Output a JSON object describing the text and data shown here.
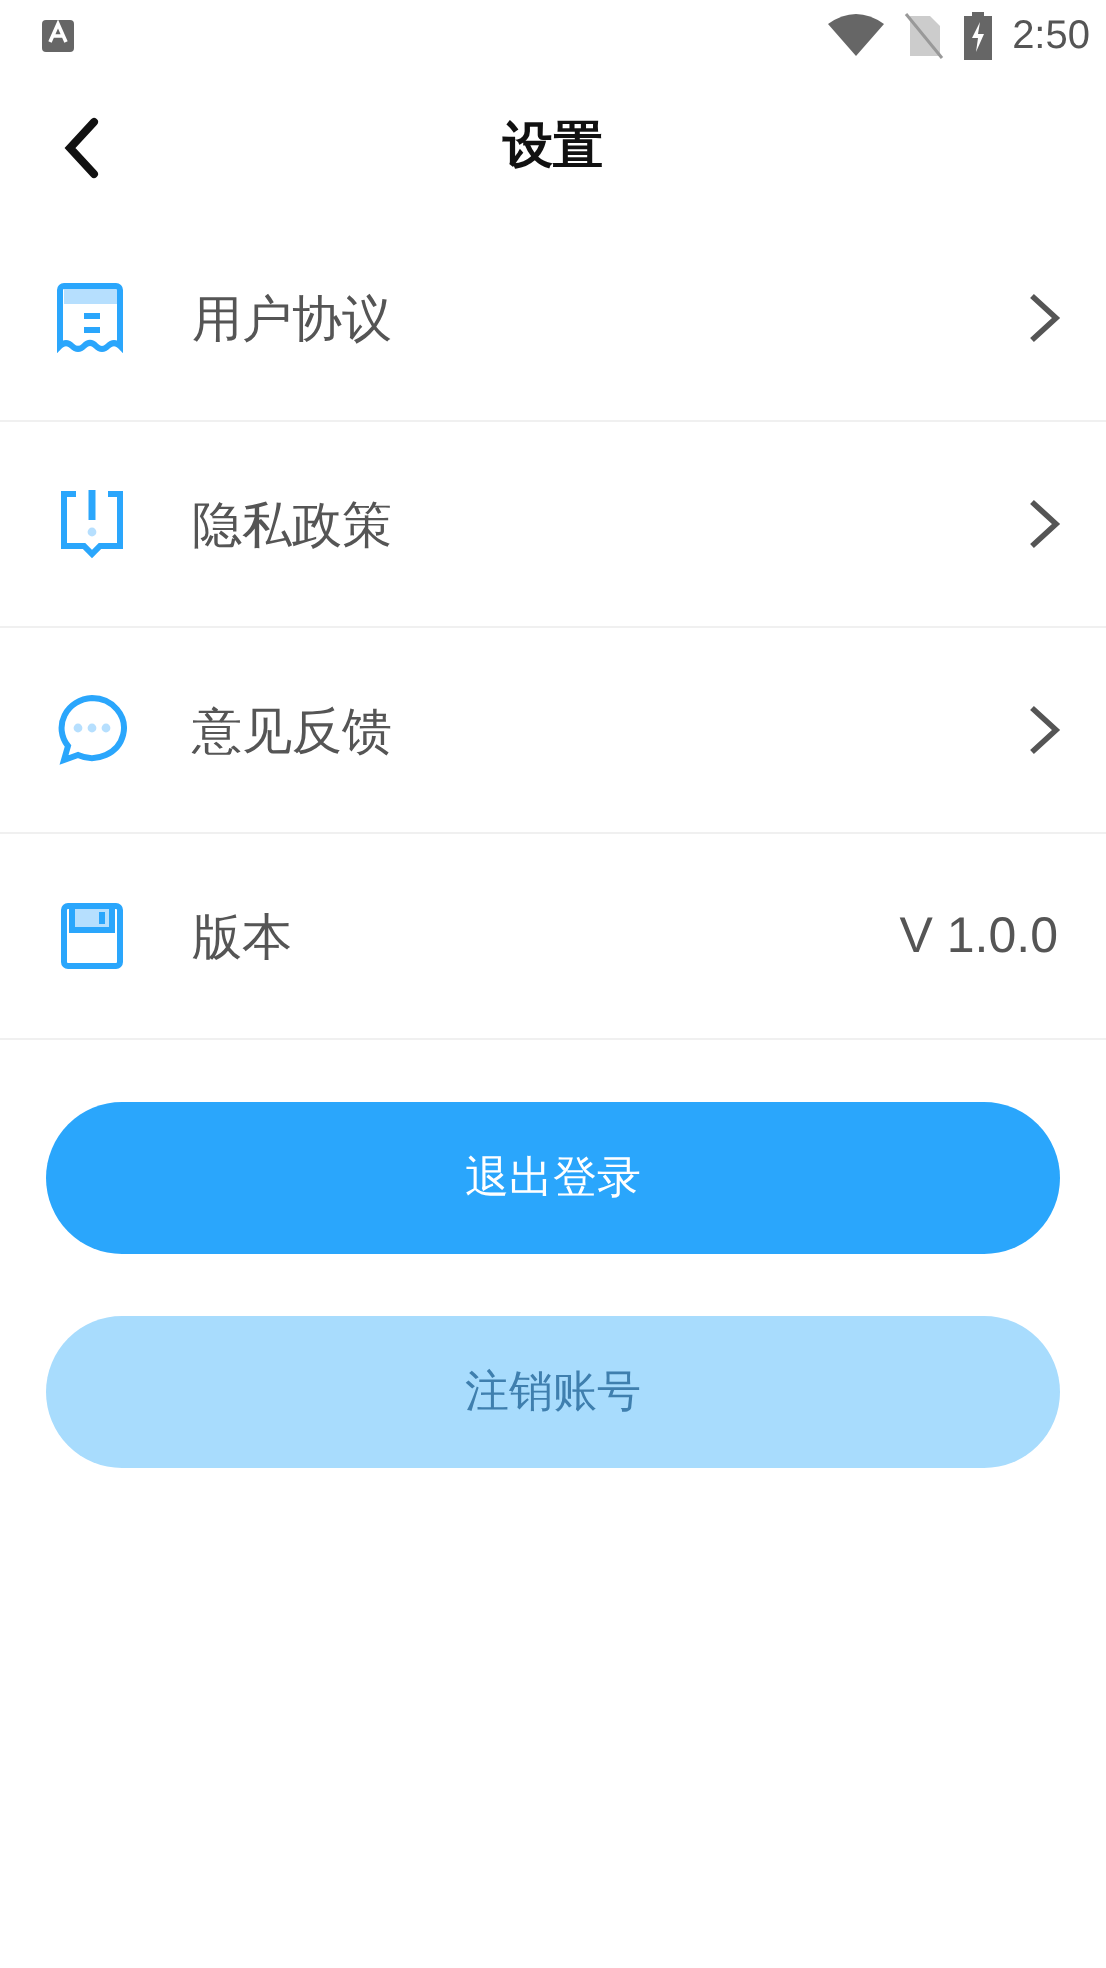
{
  "status_bar": {
    "time": "2:50"
  },
  "header": {
    "title": "设置"
  },
  "rows": [
    {
      "kind": "link",
      "label": "用户协议"
    },
    {
      "kind": "link",
      "label": "隐私政策"
    },
    {
      "kind": "link",
      "label": "意见反馈"
    },
    {
      "kind": "value",
      "label": "版本",
      "value": "V 1.0.0"
    }
  ],
  "buttons": [
    {
      "label": "退出登录",
      "disabled": false
    },
    {
      "label": "注销账号",
      "disabled": true
    }
  ]
}
